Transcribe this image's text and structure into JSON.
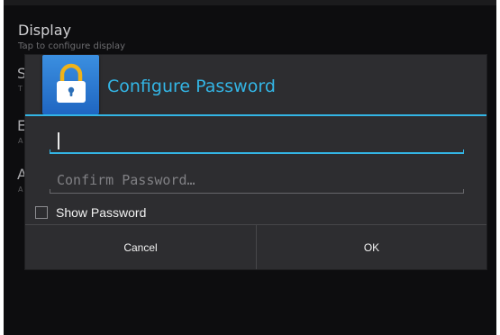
{
  "background": {
    "display_item": {
      "title": "Display",
      "subtitle": "Tap to configure display"
    },
    "partial_items": [
      {
        "letter": "S",
        "sub": "T"
      },
      {
        "letter": "E",
        "sub": "A"
      },
      {
        "letter": "A",
        "sub": "A"
      }
    ]
  },
  "dialog": {
    "icon": "lock-icon",
    "title": "Configure Password",
    "password_field": {
      "value": "",
      "placeholder": ""
    },
    "confirm_field": {
      "value": "",
      "placeholder": "Confirm Password…"
    },
    "show_password": {
      "label": "Show Password",
      "checked": false
    },
    "buttons": {
      "cancel": "Cancel",
      "ok": "OK"
    }
  },
  "colors": {
    "accent": "#33b5e5",
    "dialog_bg": "#2d2d30",
    "screen_bg": "#0d0d0f",
    "lock_tile": "#2a78d2"
  }
}
